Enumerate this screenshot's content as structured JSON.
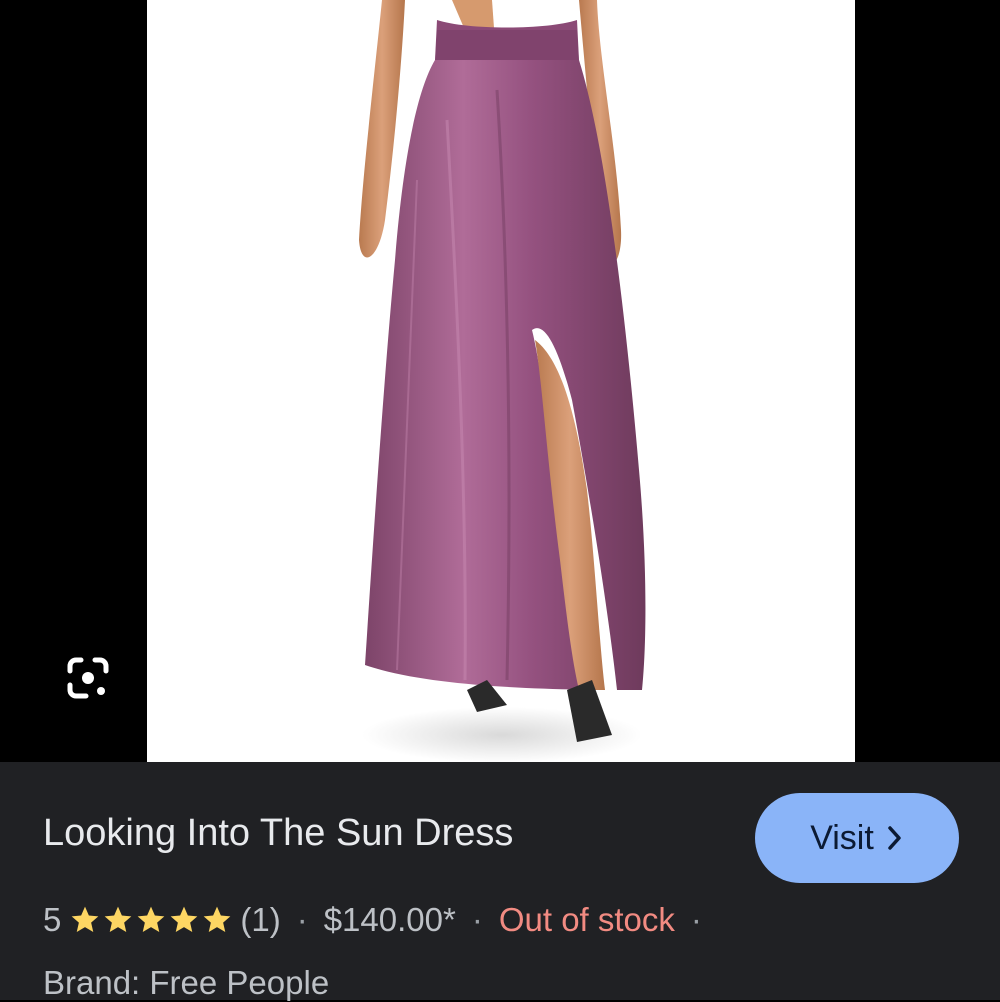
{
  "viewer": {
    "lens_icon": "google-lens-icon",
    "image_subject": "dress-product-photo"
  },
  "product": {
    "title": "Looking Into The Sun Dress",
    "visit_label": "Visit",
    "visit_icon": "chevron-right-icon",
    "rating": "5",
    "stars": 5,
    "star_color": "#fdd663",
    "review_count": "(1)",
    "separator": "·",
    "price": "$140.00*",
    "stock_status": "Out of stock",
    "stock_color": "#f28b82",
    "brand": "Brand: Free People"
  },
  "colors": {
    "panel_bg": "#202124",
    "accent": "#8ab4f8",
    "dress": "#9b5a86"
  }
}
